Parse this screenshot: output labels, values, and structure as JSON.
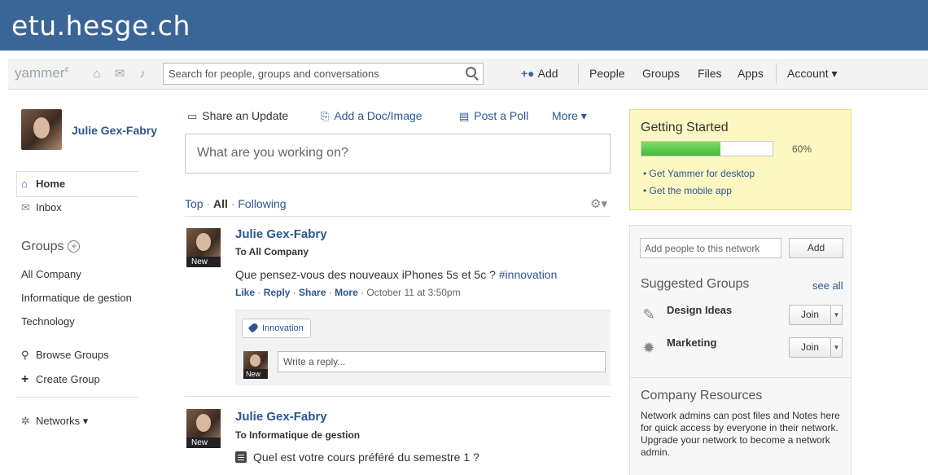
{
  "banner": {
    "title": "etu.hesge.ch"
  },
  "topbar": {
    "logo": "yammer",
    "logo_sup": "¢",
    "search_placeholder": "Search for people, groups and conversations",
    "add_label": "Add",
    "people_label": "People",
    "groups_label": "Groups",
    "files_label": "Files",
    "apps_label": "Apps",
    "account_label": "Account ▾"
  },
  "sidebar": {
    "profile_name": "Julie Gex-Fabry",
    "home_label": "Home",
    "inbox_label": "Inbox",
    "groups_heading": "Groups",
    "groups": [
      "All Company",
      "Informatique de gestion",
      "Technology"
    ],
    "browse_label": "Browse Groups",
    "create_label": "Create Group",
    "networks_label": "Networks ▾"
  },
  "publisher": {
    "tabs": [
      "Share an Update",
      "Add a Doc/Image",
      "Post a Poll",
      "More ▾"
    ],
    "placeholder": "What are you working on?"
  },
  "feed_filter": {
    "top": "Top",
    "all": "All",
    "following": "Following",
    "sep": "·"
  },
  "posts": [
    {
      "author": "Julie Gex-Fabry",
      "target": "To All Company",
      "body": "Que pensez-vous des nouveaux iPhones 5s et 5c ? ",
      "hashtag": "#innovation",
      "like": "Like",
      "reply": "Reply",
      "share": "Share",
      "more": "More",
      "timestamp": "October 11 at 3:50pm",
      "topic": "Innovation",
      "reply_placeholder": "Write a reply...",
      "badge": "New"
    },
    {
      "author": "Julie Gex-Fabry",
      "target": "To Informatique de gestion",
      "body": "Quel est votre cours préféré du semestre 1 ?",
      "badge": "New"
    }
  ],
  "getting_started": {
    "title": "Getting Started",
    "progress": 0.6,
    "progress_label": "60%",
    "links": [
      "• Get Yammer for desktop",
      "• Get the mobile app"
    ],
    "accent": "#45b83b"
  },
  "invite": {
    "placeholder": "Add people to this network",
    "button": "Add"
  },
  "suggested": {
    "title": "Suggested Groups",
    "see_all": "see all",
    "groups": [
      {
        "name": "Design Ideas",
        "join": "Join"
      },
      {
        "name": "Marketing",
        "join": "Join"
      }
    ]
  },
  "resources": {
    "title": "Company Resources",
    "text": "Network admins can post files and Notes here for quick access by everyone in their network. Upgrade your network to become a network admin."
  },
  "colors": {
    "banner": "#3a6597",
    "link": "#2c5690",
    "getting_started_bg": "#fdf8c1"
  }
}
